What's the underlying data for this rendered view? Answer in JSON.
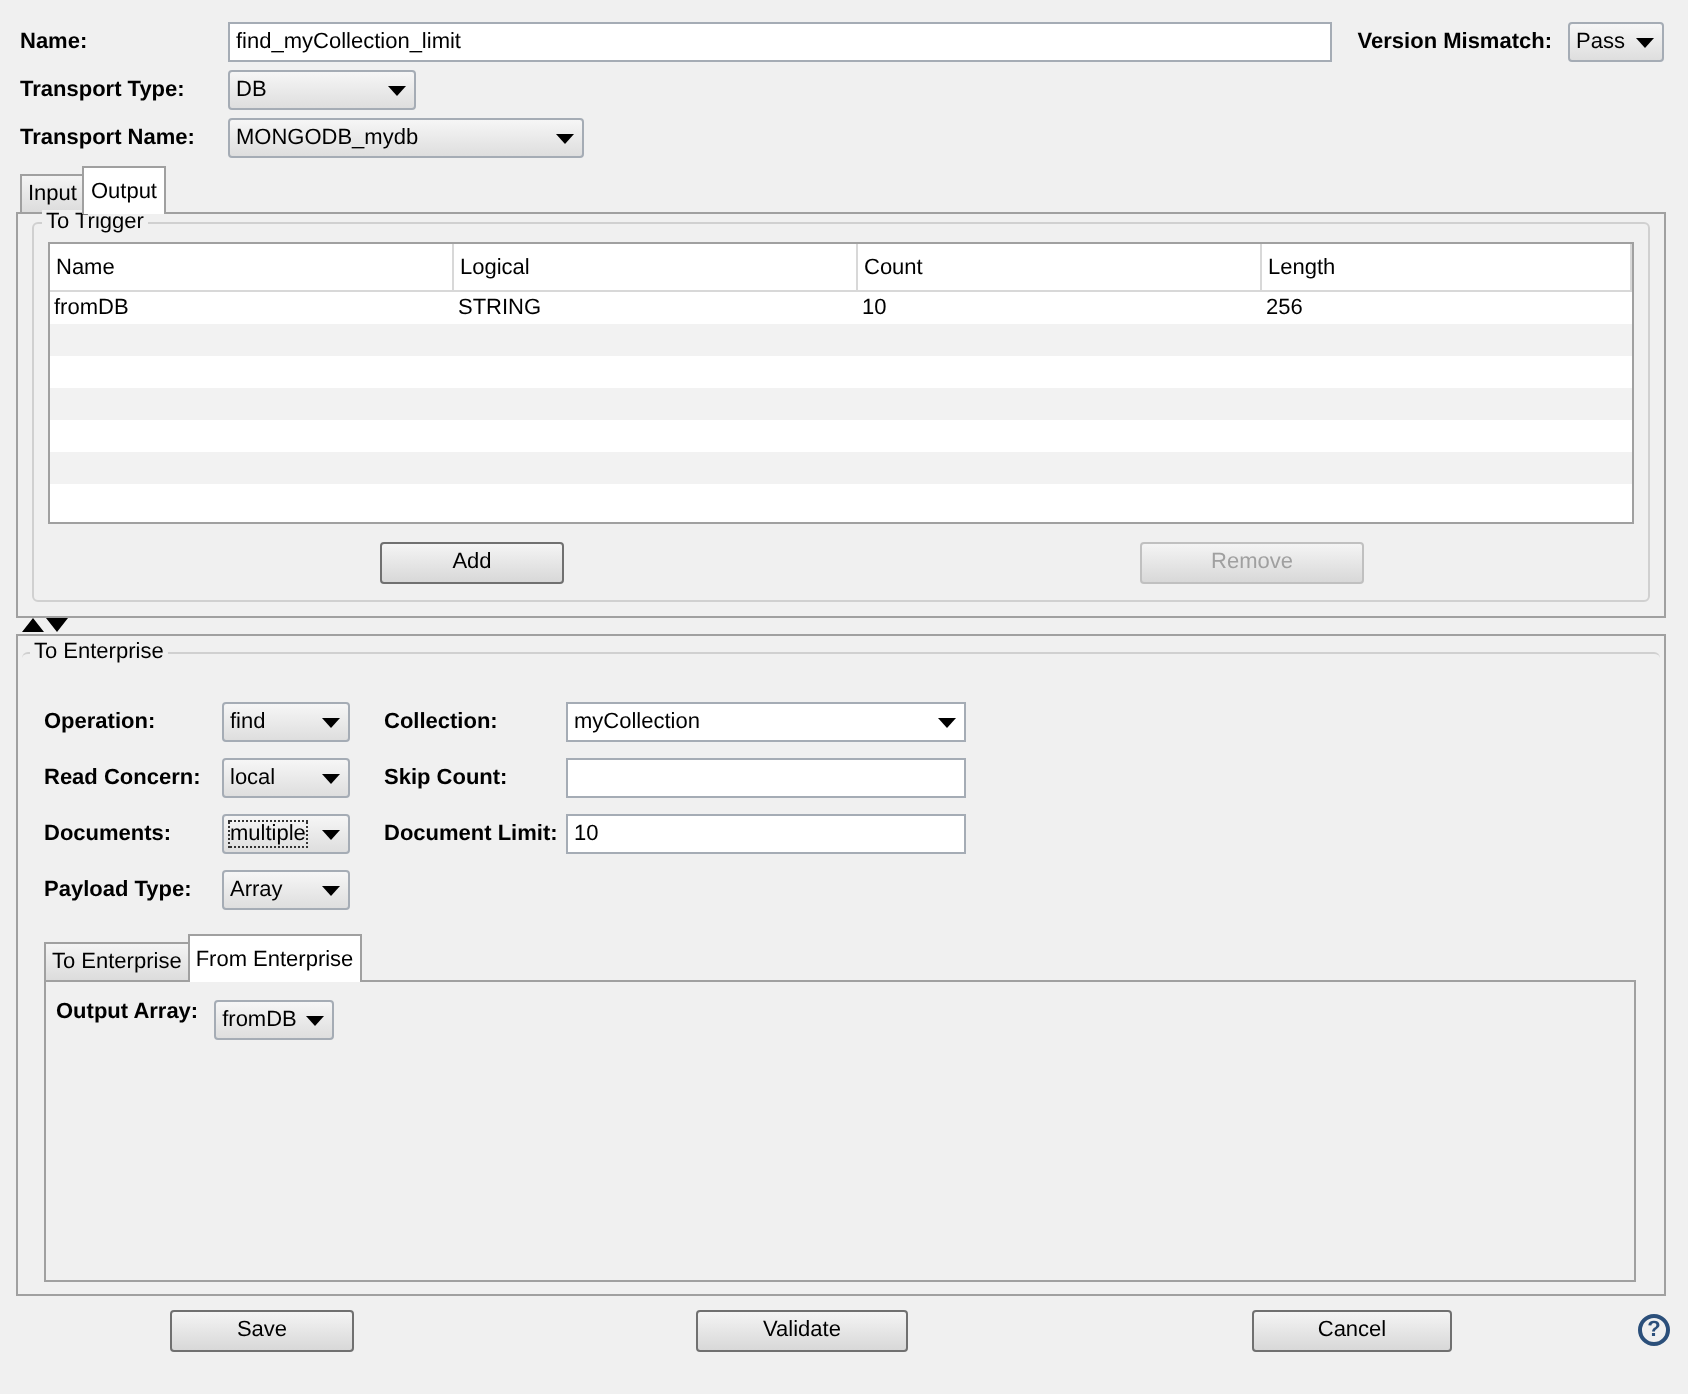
{
  "header": {
    "name_label": "Name:",
    "name_value": "find_myCollection_limit",
    "version_label": "Version Mismatch:",
    "version_value": "Pass",
    "transport_type_label": "Transport Type:",
    "transport_type_value": "DB",
    "transport_name_label": "Transport Name:",
    "transport_name_value": "MONGODB_mydb"
  },
  "tabs": [
    {
      "label": "Input",
      "selected": false
    },
    {
      "label": "Output",
      "selected": true
    }
  ],
  "to_trigger": {
    "title": "To Trigger",
    "columns": [
      "Name",
      "Logical",
      "Count",
      "Length"
    ],
    "rows": [
      [
        "fromDB",
        "STRING",
        "10",
        "256"
      ]
    ],
    "buttons": [
      {
        "label": "Add",
        "disabled": false
      },
      {
        "label": "Remove",
        "disabled": true
      }
    ]
  },
  "to_enterprise": {
    "title": "To Enterprise",
    "rows": [
      {
        "label": "Operation:",
        "value": "find",
        "focused": false,
        "right": {
          "label": "Collection:",
          "kind": "dropdown",
          "value": "myCollection"
        }
      },
      {
        "label": "Read Concern:",
        "value": "local",
        "focused": false,
        "right": {
          "label": "Skip Count:",
          "kind": "text"
        }
      },
      {
        "label": "Documents:",
        "value": "multiple",
        "focused": true,
        "right": {
          "label": "Document Limit:",
          "kind": "text",
          "value": "10"
        }
      },
      {
        "label": "Payload Type:",
        "value": "Array",
        "focused": false
      }
    ],
    "tabs": [
      {
        "label": "To Enterprise",
        "selected": false
      },
      {
        "label": "From Enterprise",
        "selected": true
      }
    ],
    "output_label": "Output Array:",
    "output_value": "fromDB"
  },
  "footer": {
    "buttons": [
      "Save",
      "Validate",
      "Cancel"
    ],
    "help": "?"
  }
}
